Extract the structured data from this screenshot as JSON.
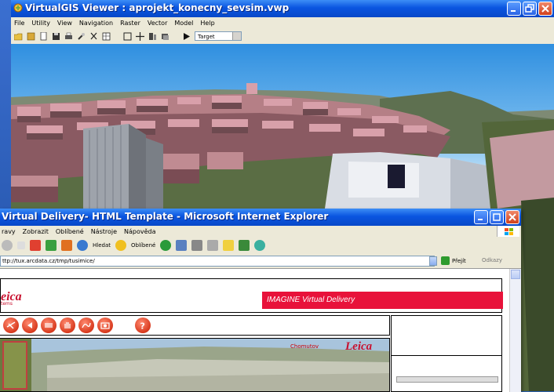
{
  "vgis": {
    "title": "VirtualGIS Viewer : aprojekt_konecny_sevsim.vwp",
    "menu": [
      "File",
      "Utility",
      "View",
      "Navigation",
      "Raster",
      "Vector",
      "Model",
      "Help"
    ],
    "target_select": "Target"
  },
  "ie": {
    "title": "Virtual Delivery- HTML Template - Microsoft Internet Explorer",
    "menu": [
      "ravy",
      "Zobrazit",
      "Oblíbené",
      "Nástroje",
      "Nápověda"
    ],
    "toolbar": {
      "search_label": "Hledat",
      "favorites_label": "Oblíbené"
    },
    "address": "ttp://tux.arcdata.cz/tmp/tusimice/",
    "go_label": "Přejít",
    "links_label": "Odkazy",
    "page": {
      "logo_text": "eica",
      "logo_sub": "tems",
      "banner_text": "IMAGINE Virtual Delivery",
      "view_label": "Chomutov",
      "view_logo": "Leica"
    }
  },
  "colors": {
    "xp_title": "#0a55e0",
    "banner_red": "#e8123a",
    "leica_red": "#c8102e"
  }
}
